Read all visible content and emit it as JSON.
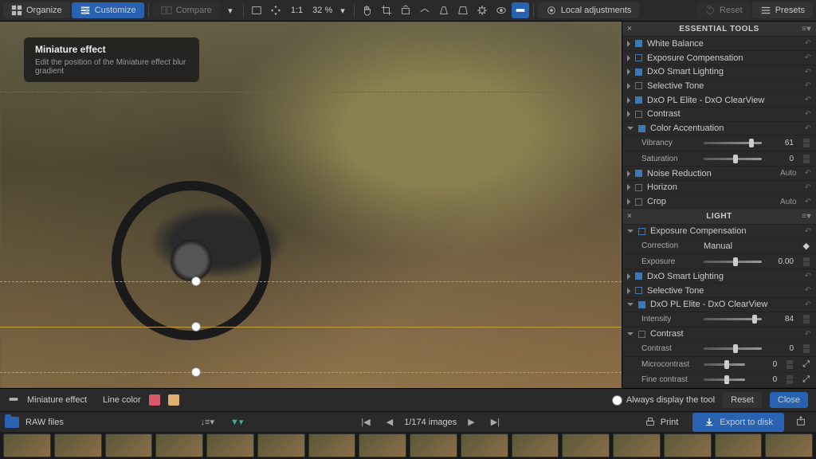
{
  "top": {
    "organize": "Organize",
    "customize": "Customize",
    "compare": "Compare",
    "zoom_ratio": "1:1",
    "zoom_pct": "32 %",
    "local_adj": "Local adjustments",
    "reset": "Reset",
    "presets": "Presets"
  },
  "tooltip": {
    "title": "Miniature effect",
    "body": "Edit the position of the Miniature effect blur gradient"
  },
  "essential": {
    "title": "ESSENTIAL TOOLS",
    "items": [
      {
        "label": "White Balance",
        "on": true
      },
      {
        "label": "Exposure Compensation",
        "on": false
      },
      {
        "label": "DxO Smart Lighting",
        "on": true
      },
      {
        "label": "Selective Tone",
        "on": false
      },
      {
        "label": "DxO PL Elite - DxO ClearView",
        "on": true
      },
      {
        "label": "Contrast",
        "on": false
      }
    ],
    "color_acc": {
      "label": "Color Accentuation",
      "on": true,
      "vibrancy_label": "Vibrancy",
      "vibrancy": 61,
      "saturation_label": "Saturation",
      "saturation": 0
    },
    "noise": {
      "label": "Noise Reduction",
      "auto": "Auto",
      "on": true
    },
    "horizon": {
      "label": "Horizon",
      "on": false
    },
    "crop": {
      "label": "Crop",
      "auto": "Auto",
      "on": false
    }
  },
  "light": {
    "title": "LIGHT",
    "exp_comp": {
      "label": "Exposure Compensation",
      "correction_label": "Correction",
      "correction": "Manual",
      "exposure_label": "Exposure",
      "exposure": "0.00"
    },
    "smart": {
      "label": "DxO Smart Lighting",
      "on": true
    },
    "selective": {
      "label": "Selective Tone",
      "on": false
    },
    "clearview": {
      "label": "DxO PL Elite - DxO ClearView",
      "on": true,
      "intensity_label": "Intensity",
      "intensity": 84
    },
    "contrast": {
      "label": "Contrast",
      "contrast_label": "Contrast",
      "contrast": 0,
      "micro_label": "Microcontrast",
      "micro": 0,
      "fine_label": "Fine contrast",
      "fine": 0
    }
  },
  "bottom": {
    "effect": "Miniature effect",
    "line_color": "Line color",
    "always": "Always display the tool",
    "reset": "Reset",
    "close": "Close"
  },
  "footer": {
    "folder": "RAW files",
    "counter": "1/174 images",
    "print": "Print",
    "export": "Export to disk"
  },
  "colors": {
    "sw1": "#d85a6a",
    "sw2": "#e0b070"
  }
}
